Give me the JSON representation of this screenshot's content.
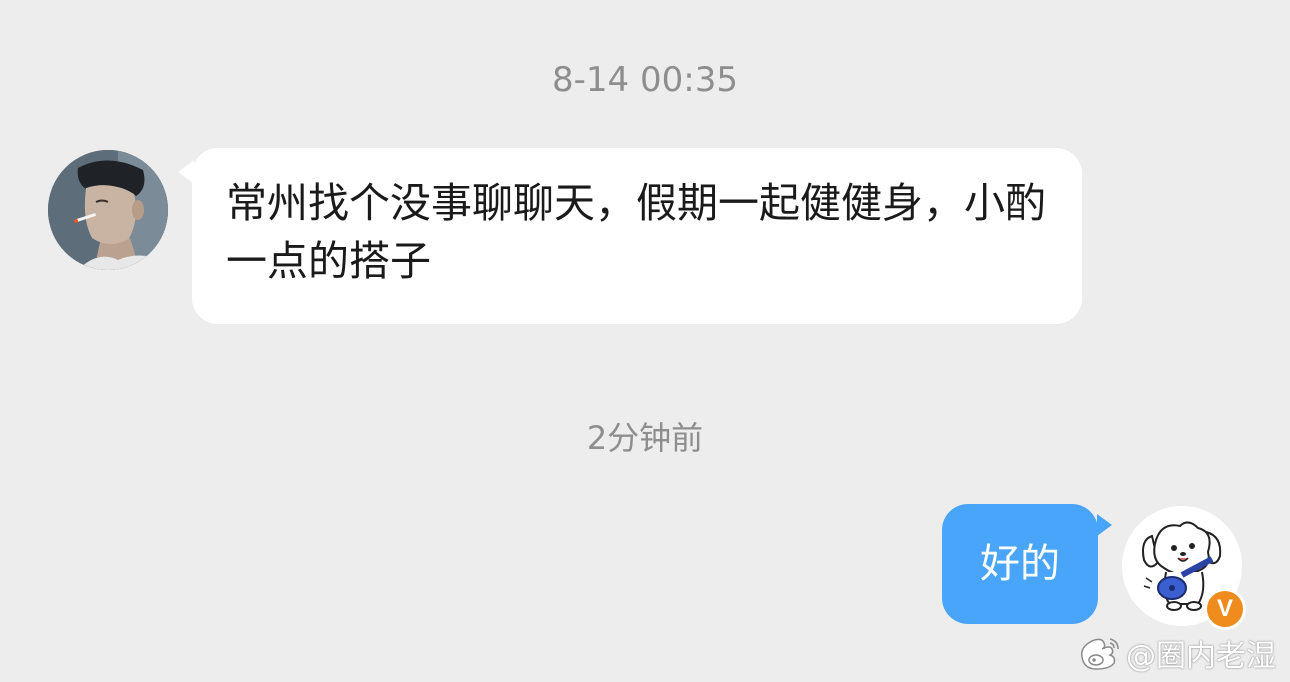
{
  "conversation": {
    "timestamps": {
      "first": "8-14 00:35",
      "second": "2分钟前"
    },
    "messages": [
      {
        "sender": "other",
        "text": "常州找个没事聊聊天，假期一起健健身，小酌一点的搭子"
      },
      {
        "sender": "self",
        "text": "好的"
      }
    ]
  },
  "self_profile": {
    "verified_badge": "V",
    "badge_color": "#f08c1e"
  },
  "bubble_colors": {
    "incoming": "#ffffff",
    "outgoing": "#48a5fa"
  },
  "watermark": {
    "text": "@圈内老湿",
    "icon": "weibo-icon"
  }
}
